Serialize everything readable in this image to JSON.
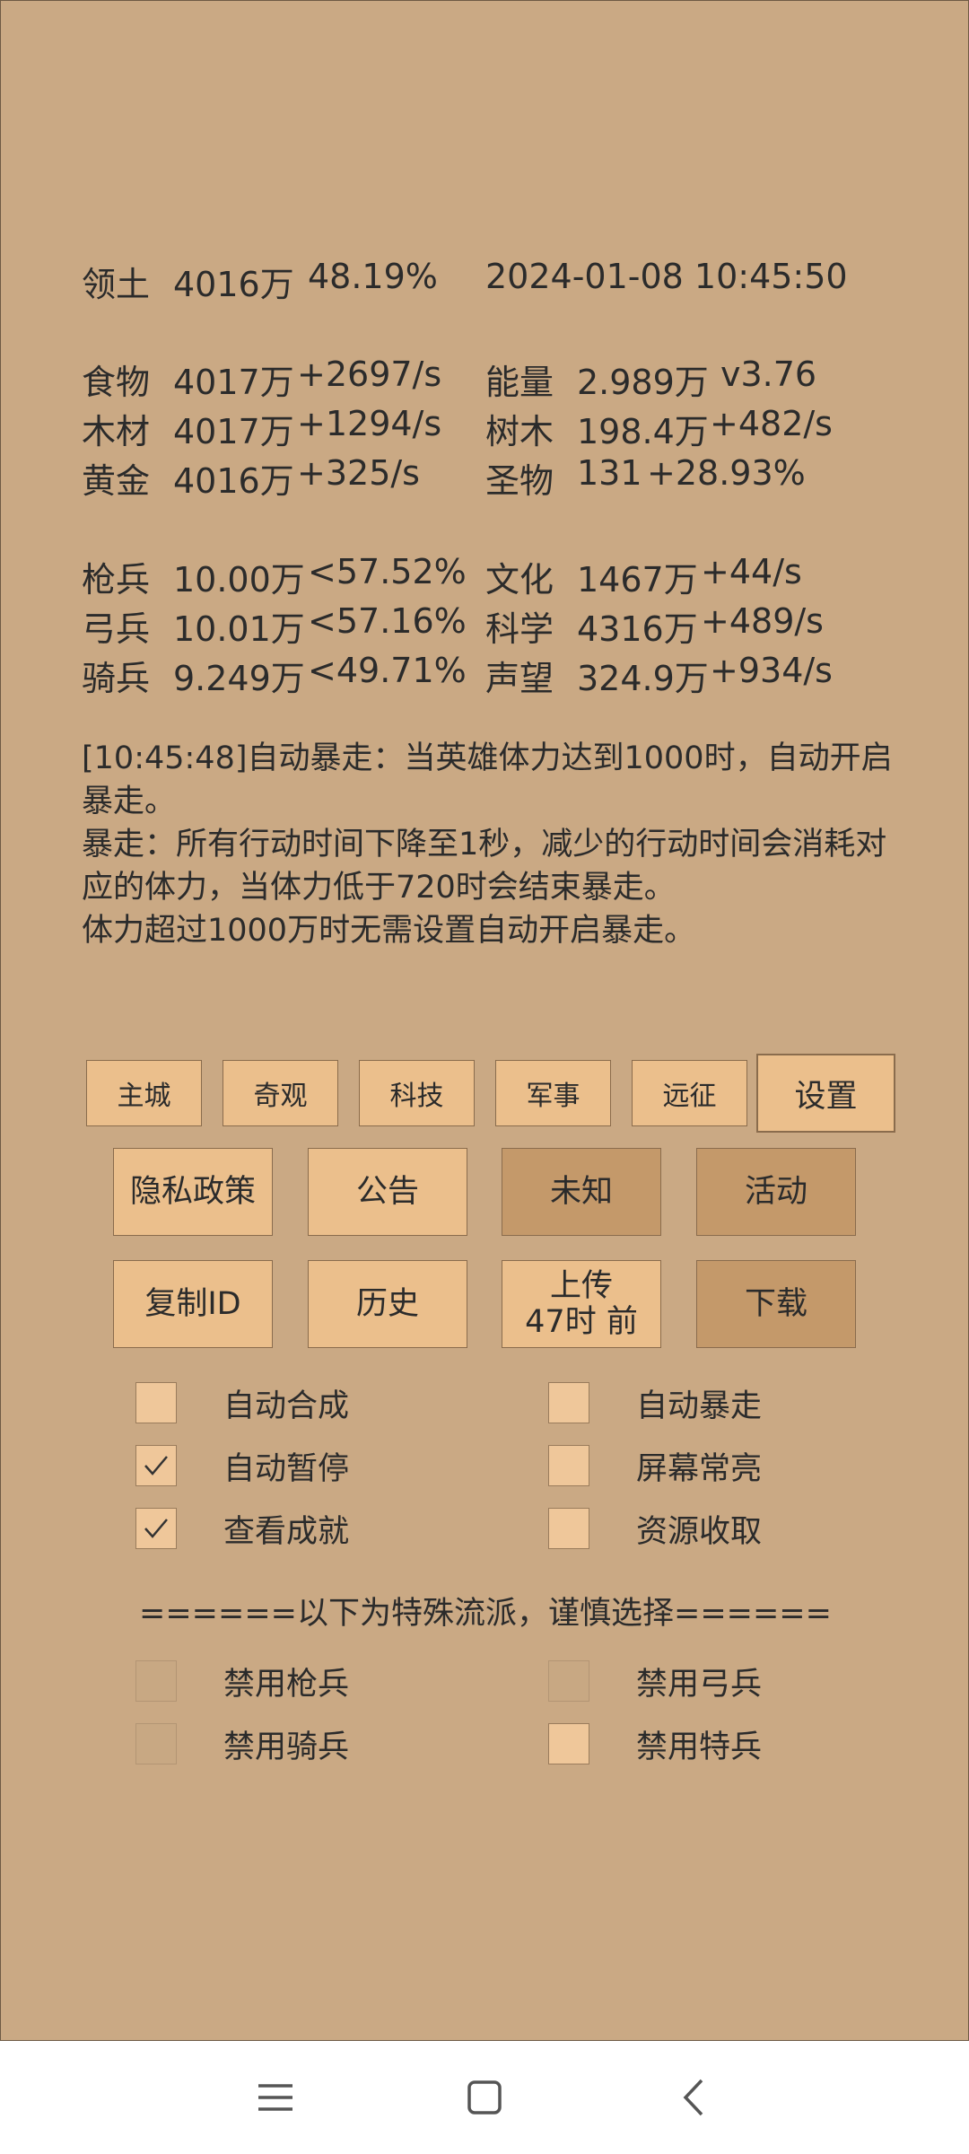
{
  "stats": {
    "territory": {
      "label": "领土",
      "value": "4016万",
      "pct": "48.19%"
    },
    "datetime": "2024-01-08 10:45:50",
    "left": [
      {
        "label": "食物",
        "value": "4017万",
        "rate": "+2697/s"
      },
      {
        "label": "木材",
        "value": "4017万",
        "rate": "+1294/s"
      },
      {
        "label": "黄金",
        "value": "4016万",
        "rate": "+325/s"
      }
    ],
    "right": [
      {
        "label": "能量",
        "value": "2.989万",
        "rate": "v3.76"
      },
      {
        "label": "树木",
        "value": "198.4万",
        "rate": "+482/s"
      },
      {
        "label": "圣物",
        "value": "131",
        "rate": "+28.93%"
      }
    ],
    "units": [
      {
        "label": "枪兵",
        "value": "10.00万",
        "rate": "<57.52%"
      },
      {
        "label": "弓兵",
        "value": "10.01万",
        "rate": "<57.16%"
      },
      {
        "label": "骑兵",
        "value": "9.249万",
        "rate": "<49.71%"
      }
    ],
    "culture": [
      {
        "label": "文化",
        "value": "1467万",
        "rate": "+44/s"
      },
      {
        "label": "科学",
        "value": "4316万",
        "rate": "+489/s"
      },
      {
        "label": "声望",
        "value": "324.9万",
        "rate": "+934/s"
      }
    ]
  },
  "message": {
    "line1": "[10:45:48]自动暴走：当英雄体力达到1000时，自动开启暴走。",
    "line2": "暴走：所有行动时间下降至1秒，减少的行动时间会消耗对应的体力，当体力低于720时会结束暴走。",
    "line3": "体力超过1000万时无需设置自动开启暴走。"
  },
  "tabs": [
    "主城",
    "奇观",
    "科技",
    "军事",
    "远征",
    "设置"
  ],
  "buttons_row1": [
    "隐私政策",
    "公告",
    "未知",
    "活动"
  ],
  "buttons_row2": {
    "copy": "复制ID",
    "history": "历史",
    "upload_line1": "上传",
    "upload_line2": "47时 前",
    "download": "下载"
  },
  "options": [
    {
      "label": "自动合成",
      "checked": false
    },
    {
      "label": "自动暴走",
      "checked": false
    },
    {
      "label": "自动暂停",
      "checked": true
    },
    {
      "label": "屏幕常亮",
      "checked": false
    },
    {
      "label": "查看成就",
      "checked": true
    },
    {
      "label": "资源收取",
      "checked": false
    }
  ],
  "divider": "======以下为特殊流派，谨慎选择======",
  "special": [
    {
      "label": "禁用枪兵",
      "disabled": true
    },
    {
      "label": "禁用弓兵",
      "disabled": true
    },
    {
      "label": "禁用骑兵",
      "disabled": true
    },
    {
      "label": "禁用特兵",
      "disabled": false
    }
  ]
}
